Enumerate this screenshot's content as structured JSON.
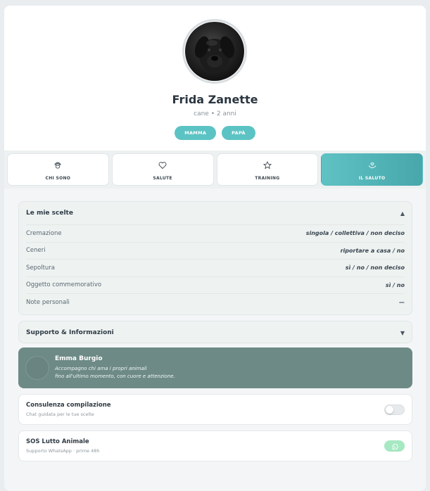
{
  "pet": {
    "name": "Frida Zanette",
    "subtitle": "cane • 2 anni"
  },
  "chips": [
    "MAMMA",
    "PAPÀ"
  ],
  "tabs": [
    {
      "label": "CHI SONO",
      "icon": "paw-icon",
      "active": false
    },
    {
      "label": "SALUTE",
      "icon": "heart-icon",
      "active": false
    },
    {
      "label": "TRAINING",
      "icon": "star-icon",
      "active": false
    },
    {
      "label": "IL SALUTO",
      "icon": "hands-heart-icon",
      "active": true
    }
  ],
  "choices": {
    "title": "Le mie scelte",
    "caret": "▲",
    "rows": [
      {
        "label": "Cremazione",
        "value": "singola / collettiva / non deciso"
      },
      {
        "label": "Ceneri",
        "value": "riportare a casa / no"
      },
      {
        "label": "Sepoltura",
        "value": "sì / no / non deciso"
      },
      {
        "label": "Oggetto commemorativo",
        "value": "sì / no"
      },
      {
        "label": "Note personali",
        "value": "—"
      }
    ]
  },
  "support": {
    "title": "Supporto & Informazioni",
    "caret": "▼"
  },
  "profile": {
    "name": "Emma Burgio",
    "line1": "Accompagno chi ama i propri animali",
    "line2": "fino all'ultimo momento, con cuore e attenzione."
  },
  "consulting": {
    "title": "Consulenza compilazione",
    "subtitle": "Chat guidata per le tue scelte",
    "toggle_on": false
  },
  "sos": {
    "title": "SOS Lutto Animale",
    "subtitle": "Supporto WhatsApp · prime 48h",
    "icon": "whatsapp-icon"
  },
  "colors": {
    "accent": "#5cc3c4",
    "profile_bg": "#6d8a86",
    "whatsapp": "#a6e8c2"
  }
}
